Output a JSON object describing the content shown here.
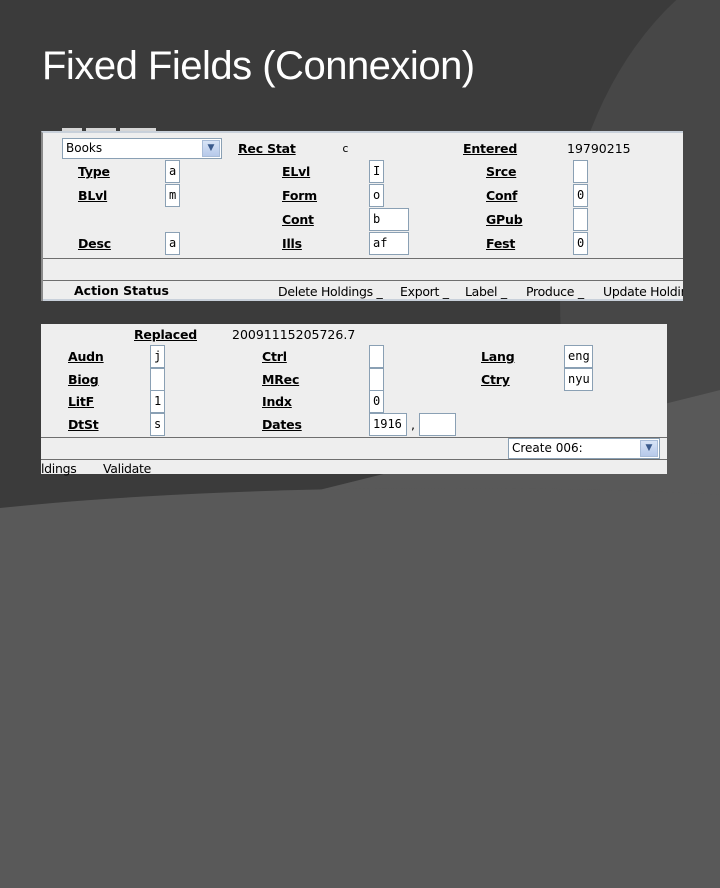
{
  "slide": {
    "title": "Fixed Fields (Connexion)"
  },
  "colors": {
    "background": "#3b3b3b",
    "panel": "#eeeeee",
    "field_border": "#8aa0b4"
  },
  "top_panel": {
    "format_select": {
      "value": "Books",
      "icon": "chevron-down-icon"
    },
    "rec_stat": {
      "label": "Rec Stat",
      "value": "c"
    },
    "entered": {
      "label": "Entered",
      "value": "19790215"
    },
    "fields": {
      "type": {
        "label": "Type",
        "value": "a"
      },
      "blvl": {
        "label": "BLvl",
        "value": "m"
      },
      "desc": {
        "label": "Desc",
        "value": "a"
      },
      "elvl": {
        "label": "ELvl",
        "value": "I"
      },
      "form": {
        "label": "Form",
        "value": "o"
      },
      "cont": {
        "label": "Cont",
        "value": "b"
      },
      "ills": {
        "label": "Ills",
        "value": "af"
      },
      "srce": {
        "label": "Srce",
        "value": ""
      },
      "conf": {
        "label": "Conf",
        "value": "0"
      },
      "gpub": {
        "label": "GPub",
        "value": ""
      },
      "fest": {
        "label": "Fest",
        "value": "0"
      }
    },
    "action_status": {
      "label": "Action Status",
      "items": [
        "Delete Holdings _",
        "Export _",
        "Label _",
        "Produce _",
        "Update Holdir"
      ]
    }
  },
  "bottom_panel": {
    "replaced": {
      "label": "Replaced",
      "value": "20091115205726.7"
    },
    "fields": {
      "audn": {
        "label": "Audn",
        "value": "j"
      },
      "biog": {
        "label": "Biog",
        "value": ""
      },
      "litf": {
        "label": "LitF",
        "value": "1"
      },
      "dtst": {
        "label": "DtSt",
        "value": "s"
      },
      "ctrl": {
        "label": "Ctrl",
        "value": ""
      },
      "mrec": {
        "label": "MRec",
        "value": ""
      },
      "indx": {
        "label": "Indx",
        "value": "0"
      },
      "dates": {
        "label": "Dates",
        "value1": "1916",
        "separator": ",",
        "value2": ""
      },
      "lang": {
        "label": "Lang",
        "value": "eng"
      },
      "ctry": {
        "label": "Ctry",
        "value": "nyu"
      }
    },
    "create_006_select": {
      "value": "Create 006:",
      "icon": "chevron-down-icon"
    },
    "footer_items": [
      "ldings",
      "Validate"
    ]
  }
}
